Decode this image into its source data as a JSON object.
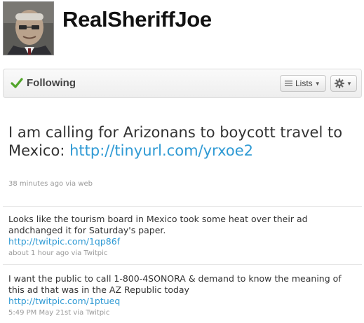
{
  "profile": {
    "username": "RealSheriffJoe"
  },
  "follow_bar": {
    "following_label": "Following",
    "lists_label": "Lists"
  },
  "main_tweet": {
    "text": "I am calling for Arizonans to boycott travel to Mexico:",
    "link": "http://tinyurl.com/yrxoe2",
    "time": "38 minutes ago",
    "via": "via web"
  },
  "tweets": [
    {
      "text": "Looks like the tourism board in Mexico took some heat over their ad andchanged it for Saturday's paper.",
      "link": "http://twitpic.com/1qp86f",
      "time": "about 1 hour ago",
      "via": "via Twitpic"
    },
    {
      "text": "I want the public to call 1-800-4SONORA & demand to know the meaning of this ad that was in the AZ Republic today",
      "link": "http://twitpic.com/1ptueq",
      "time": "5:49 PM May 21st",
      "via": "via Twitpic"
    }
  ],
  "colors": {
    "link": "#2f9ad4",
    "check": "#52a52a",
    "meta": "#999999"
  },
  "icons": [
    "avatar-photo",
    "check-icon",
    "lines-icon",
    "chevron-down-icon",
    "gear-icon"
  ]
}
